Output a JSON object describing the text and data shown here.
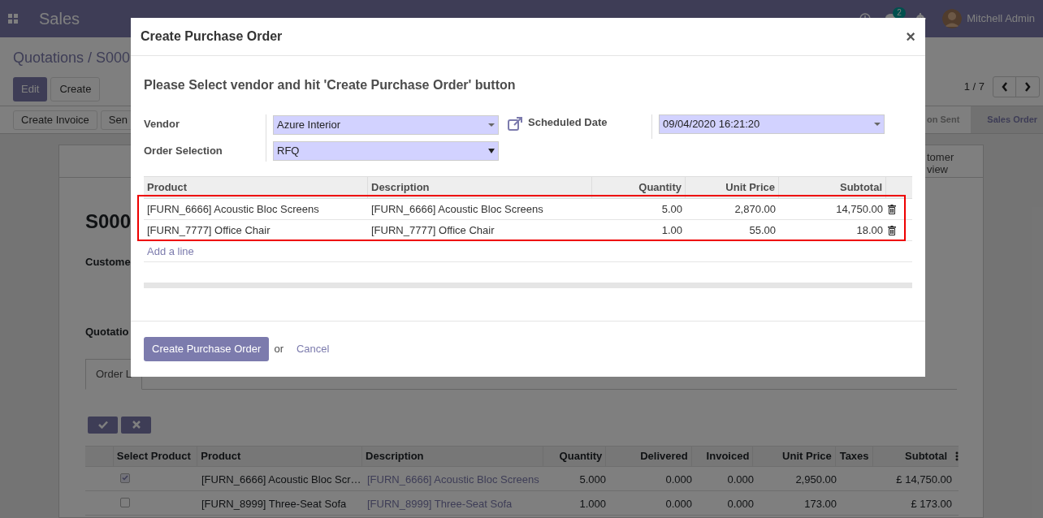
{
  "navbar": {
    "app_title": "Sales",
    "chat_badge": "2",
    "user": "Mitchell Admin"
  },
  "control_panel": {
    "breadcrumb": "Quotations / S000",
    "buttons": [
      "Edit",
      "Create"
    ],
    "pager": "1 / 7"
  },
  "statusbar": {
    "buttons": [
      "Create Invoice",
      "Sen"
    ],
    "stages": [
      {
        "label": "on Sent",
        "selected": false
      },
      {
        "label": "Sales Order",
        "selected": true
      }
    ]
  },
  "sheet": {
    "smart_button": "tomer view",
    "title": "S000",
    "labels": [
      "Custome",
      "Quotatio"
    ],
    "tab": "Order L",
    "table": {
      "select_column": "Select Product",
      "columns": [
        "Product",
        "Description",
        "Quantity",
        "Delivered",
        "Invoiced",
        "Unit Price",
        "Taxes",
        "Subtotal"
      ],
      "rows": [
        {
          "checked": true,
          "cells": [
            "[FURN_6666] Acoustic Bloc Scr…",
            "[FURN_6666] Acoustic Bloc Screens",
            "5.000",
            "0.000",
            "0.000",
            "2,950.00",
            "",
            "£ 14,750.00"
          ]
        },
        {
          "checked": false,
          "cells": [
            "[FURN_8999] Three-Seat Sofa",
            "[FURN_8999] Three-Seat Sofa",
            "1.000",
            "0.000",
            "0.000",
            "173.00",
            "",
            "£ 173.00"
          ]
        }
      ]
    }
  },
  "modal": {
    "title": "Create Purchase Order",
    "close": "×",
    "subtitle": "Please Select vendor and hit 'Create Purchase Order' button",
    "fields": [
      {
        "label": "Vendor",
        "value": "Azure Interior"
      },
      {
        "label": "Order Selection",
        "value": "RFQ"
      }
    ],
    "date_field": {
      "label": "Scheduled Date",
      "value": "09/04/2020 16:21:20"
    },
    "table": {
      "columns": [
        "Product",
        "Description",
        "Quantity",
        "Unit Price",
        "Subtotal"
      ],
      "rows": [
        {
          "cells": [
            "[FURN_6666] Acoustic Bloc Screens",
            "[FURN_6666] Acoustic Bloc Screens",
            "5.00",
            "2,870.00",
            "14,750.00"
          ]
        },
        {
          "cells": [
            "[FURN_7777] Office Chair",
            "[FURN_7777] Office Chair",
            "1.00",
            "55.00",
            "18.00"
          ]
        }
      ],
      "add_line": "Add a line"
    },
    "primary_button": "Create Purchase Order",
    "or_text": "or",
    "cancel": "Cancel"
  }
}
